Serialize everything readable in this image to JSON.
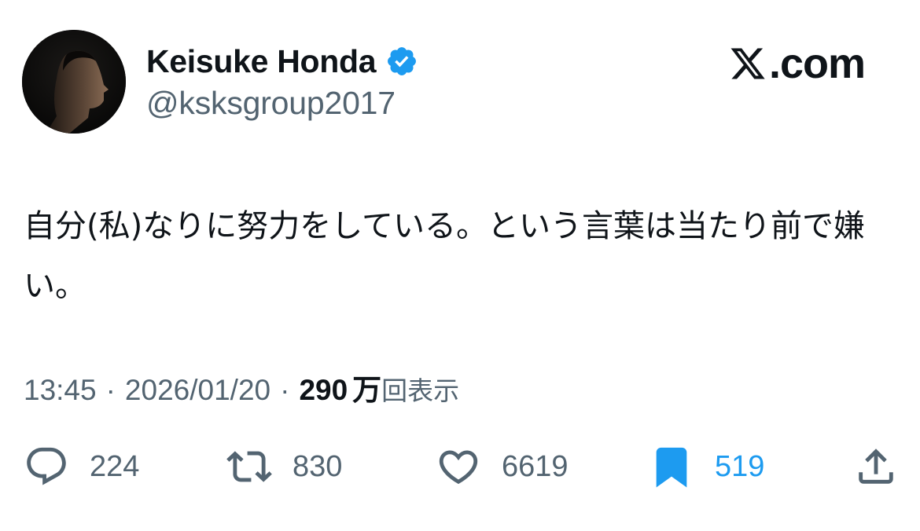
{
  "author": {
    "display_name": "Keisuke Honda",
    "handle": "@ksksgroup2017",
    "verified": true,
    "avatar_icon": "profile-photo",
    "verified_icon": "verified-badge-icon",
    "verified_color": "#1d9bf0"
  },
  "brand": {
    "text": ".com",
    "icon": "x-logo-icon"
  },
  "tweet": {
    "text": "自分(私)なりに努力をしている。という言葉は当たり前で嫌い。"
  },
  "meta": {
    "time": "13:45",
    "separator": "·",
    "date": "2026/01/20",
    "views_count": "290",
    "views_unit": "万",
    "views_label": "回表示"
  },
  "actions": {
    "reply": {
      "icon": "reply-icon",
      "count": "224"
    },
    "retweet": {
      "icon": "retweet-icon",
      "count": "830"
    },
    "like": {
      "icon": "heart-icon",
      "count": "6619"
    },
    "bookmark": {
      "icon": "bookmark-icon",
      "count": "519",
      "active": true,
      "color": "#1d9bf0"
    },
    "share": {
      "icon": "share-icon"
    }
  },
  "colors": {
    "text_primary": "#0f1419",
    "text_secondary": "#536471",
    "accent": "#1d9bf0"
  }
}
